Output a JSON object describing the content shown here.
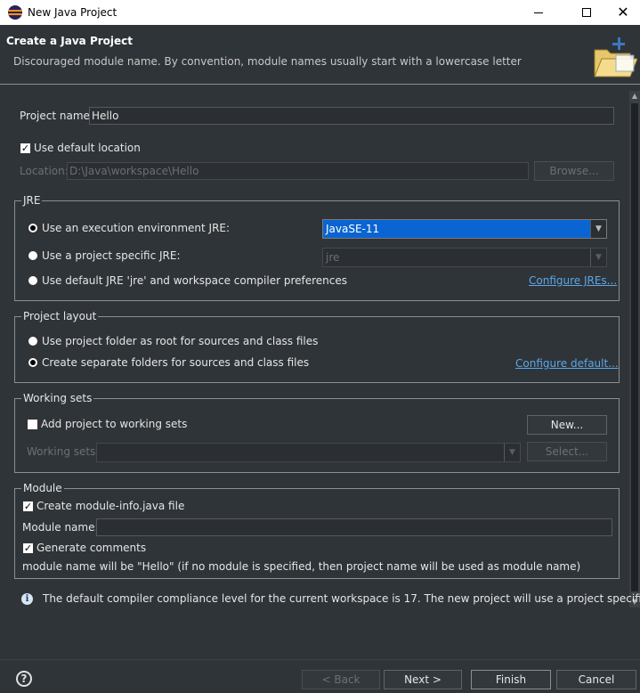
{
  "window": {
    "title": "New Java Project"
  },
  "header": {
    "title": "Create a Java Project",
    "message": "Discouraged module name. By convention, module names usually start with a lowercase letter"
  },
  "project": {
    "name_label": "Project name:",
    "name_value": "Hello",
    "use_default_location_label": "Use default location",
    "use_default_location_checked": true,
    "location_label": "Location:",
    "location_value": "D:\\Java\\workspace\\Hello",
    "browse_label": "Browse..."
  },
  "jre": {
    "group_title": "JRE",
    "exec_env_label": "Use an execution environment JRE:",
    "exec_env_value": "JavaSE-11",
    "specific_label": "Use a project specific JRE:",
    "specific_value": "jre",
    "default_label": "Use default JRE 'jre' and workspace compiler preferences",
    "configure_link": "Configure JREs..."
  },
  "layout": {
    "group_title": "Project layout",
    "root_label": "Use project folder as root for sources and class files",
    "separate_label": "Create separate folders for sources and class files",
    "configure_link": "Configure default..."
  },
  "working_sets": {
    "group_title": "Working sets",
    "add_label": "Add project to working sets",
    "new_label": "New...",
    "sets_label": "Working sets:",
    "select_label": "Select..."
  },
  "module": {
    "group_title": "Module",
    "create_label": "Create module-info.java file",
    "name_label": "Module name:",
    "generate_label": "Generate comments",
    "note": "module name will be \"Hello\"  (if no module is specified, then project name will be used as module name)"
  },
  "info": {
    "message": "The default compiler compliance level for the current workspace is 17. The new project will use a project specific"
  },
  "buttons": {
    "back": "< Back",
    "next": "Next >",
    "finish": "Finish",
    "cancel": "Cancel"
  }
}
